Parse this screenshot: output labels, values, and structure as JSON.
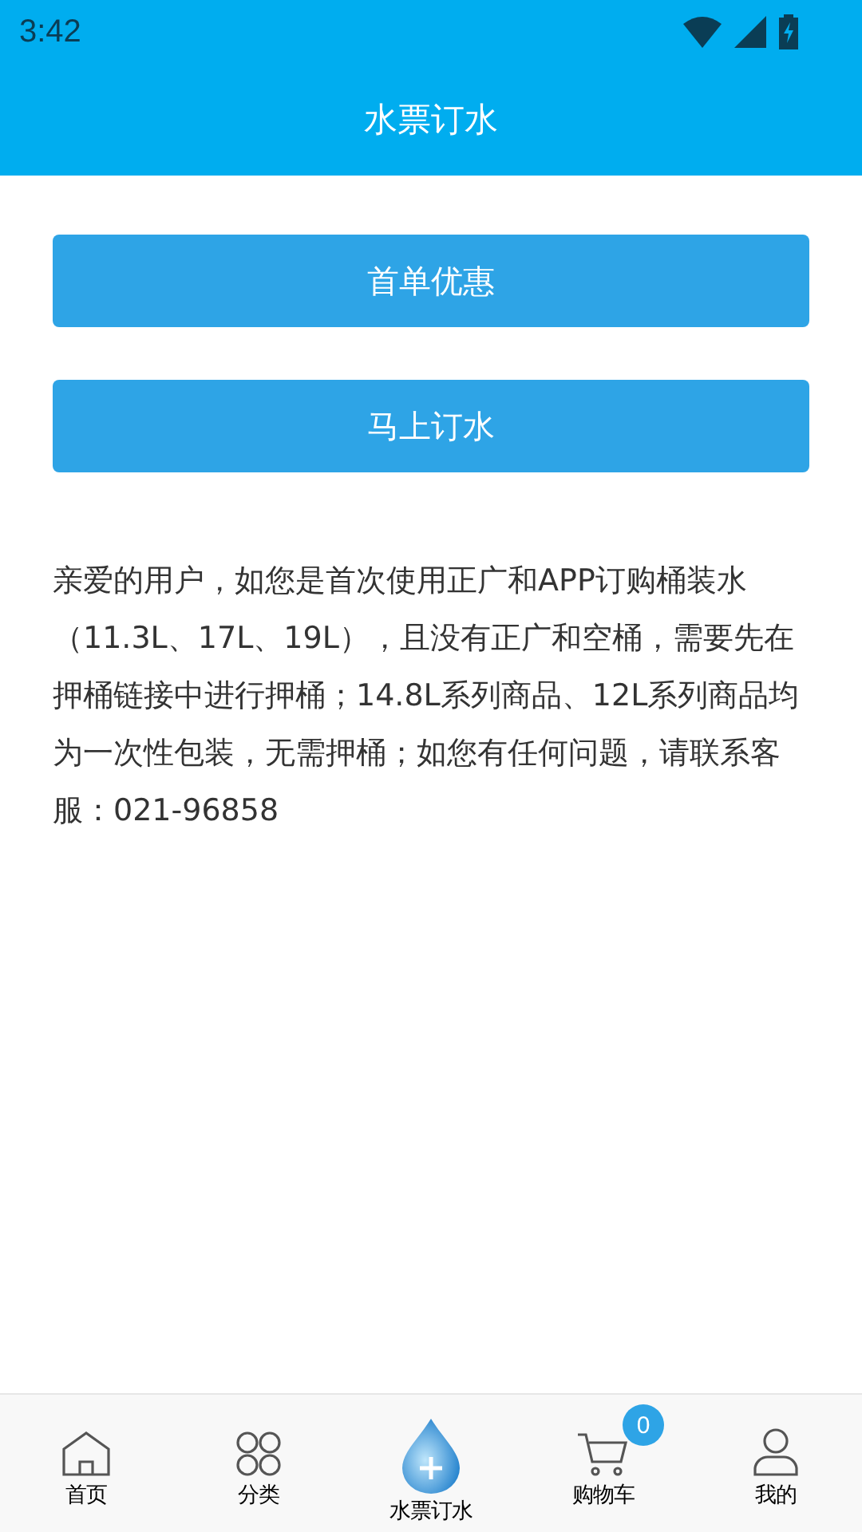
{
  "status_bar": {
    "time": "3:42"
  },
  "header": {
    "title": "水票订水"
  },
  "buttons": [
    "首单优惠",
    "马上订水"
  ],
  "notice": "亲爱的用户，如您是首次使用正广和APP订购桶装水（11.3L、17L、19L），且没有正广和空桶，需要先在押桶链接中进行押桶；14.8L系列商品、12L系列商品均为一次性包装，无需押桶；如您有任何问题，请联系客服：021-96858",
  "tab_bar": [
    {
      "kind": "home",
      "label": "首页"
    },
    {
      "kind": "grid",
      "label": "分类"
    },
    {
      "kind": "drop",
      "label": "水票订水"
    },
    {
      "kind": "cart",
      "label": "购物车",
      "badge": "0"
    },
    {
      "kind": "user",
      "label": "我的"
    }
  ]
}
